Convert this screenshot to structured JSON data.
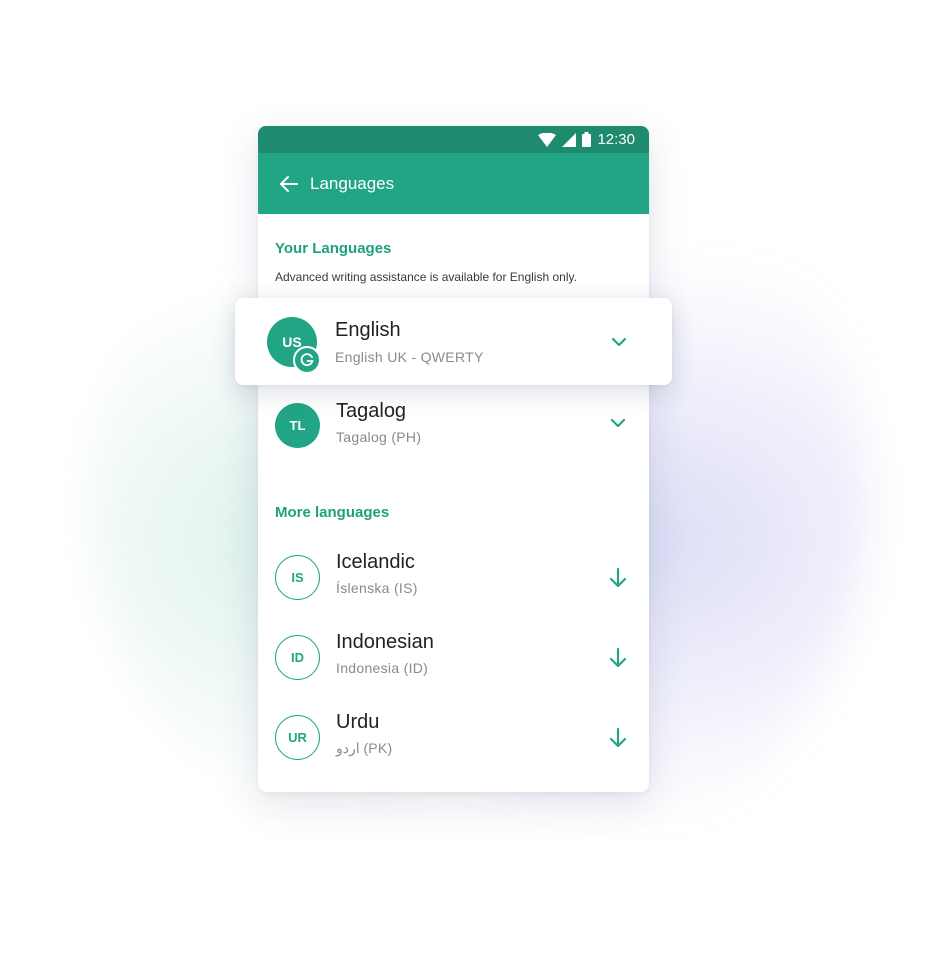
{
  "status_bar": {
    "time": "12:30"
  },
  "app_bar": {
    "title": "Languages"
  },
  "your_languages": {
    "heading": "Your Languages",
    "note": "Advanced writing assistance is available for English only.",
    "items": [
      {
        "code": "US",
        "name": "English",
        "subtitle": "English UK - QWERTY",
        "action_icon": "chevron-down-icon",
        "highlighted": true,
        "badge_icon": "grammarly-g-icon"
      },
      {
        "code": "TL",
        "name": "Tagalog",
        "subtitle": "Tagalog (PH)",
        "action_icon": "chevron-down-icon"
      }
    ]
  },
  "more_languages": {
    "heading": "More languages",
    "items": [
      {
        "code": "IS",
        "name": "Icelandic",
        "subtitle": "Íslenska (IS)",
        "action_icon": "download-arrow-icon"
      },
      {
        "code": "ID",
        "name": "Indonesian",
        "subtitle": "Indonesia (ID)",
        "action_icon": "download-arrow-icon"
      },
      {
        "code": "UR",
        "name": "Urdu",
        "subtitle": "اردو (PK)",
        "action_icon": "download-arrow-icon"
      }
    ]
  },
  "colors": {
    "primary": "#22a584",
    "status_bar": "#1e8a6e",
    "accent_text": "#1fa07e"
  }
}
